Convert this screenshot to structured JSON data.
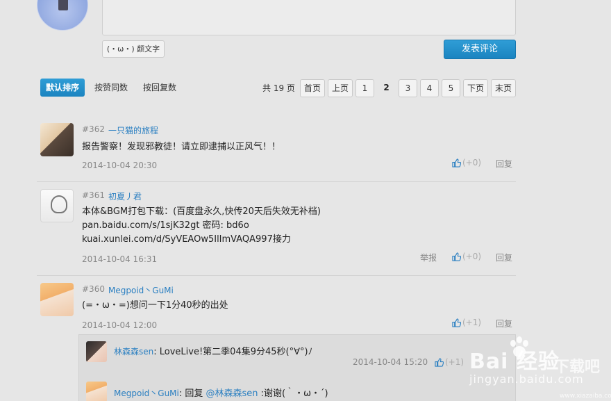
{
  "composer": {
    "emoji_label": "(・ω・) 颜文字",
    "submit_label": "发表评论"
  },
  "sort": {
    "default_label": "默认排序",
    "by_likes_label": "按赞同数",
    "by_replies_label": "按回复数"
  },
  "pagination": {
    "total_label": "共 19 页",
    "first": "首页",
    "prev": "上页",
    "pages": [
      "1",
      "2",
      "3",
      "4",
      "5"
    ],
    "current_page": "2",
    "next": "下页",
    "last": "末页"
  },
  "comments": [
    {
      "number": "#362",
      "user": "一只猫的旅程",
      "lines": [
        "报告警察！发现邪教徒！请立即逮捕以正风气！！"
      ],
      "time": "2014-10-04 20:30",
      "likes": "(+0)",
      "reply_label": "回复"
    },
    {
      "number": "#361",
      "user": "初夏丿君",
      "lines": [
        "本体&BGM打包下载：(百度盘永久,快传20天后失效无补档)",
        "pan.baidu.com/s/1sjK32gt 密码: bd6o",
        "kuai.xunlei.com/d/SyVEAOw5IlImVAQA997接力"
      ],
      "time": "2014-10-04 16:31",
      "report_label": "举报",
      "likes": "(+0)",
      "reply_label": "回复"
    },
    {
      "number": "#360",
      "user": "Megpoid丶GuMi",
      "lines": [
        "(=・ω・=)想问一下1分40秒的出处"
      ],
      "time": "2014-10-04 12:00",
      "likes": "(+1)",
      "reply_label": "回复",
      "sub_replies": [
        {
          "user": "林森森sen",
          "text": ": LoveLive!第二季04集9分45秒(°∀°)ﾉ",
          "time": "2014-10-04 15:20",
          "likes": "(+1)"
        },
        {
          "user": "Megpoid丶GuMi",
          "prefix": ": 回复 ",
          "mention": "@林森森sen",
          "text": " :谢谢(｀・ω・´)"
        }
      ]
    }
  ],
  "watermark": {
    "logo": "Bai 经验",
    "sub": "jingyan.baidu.com",
    "right_mark": "下载吧",
    "site": "www.xiazaiba.com"
  },
  "colors": {
    "accent": "#1b84c0",
    "link": "#2a7fc1",
    "muted": "#888888",
    "background": "#e6e6e6"
  }
}
